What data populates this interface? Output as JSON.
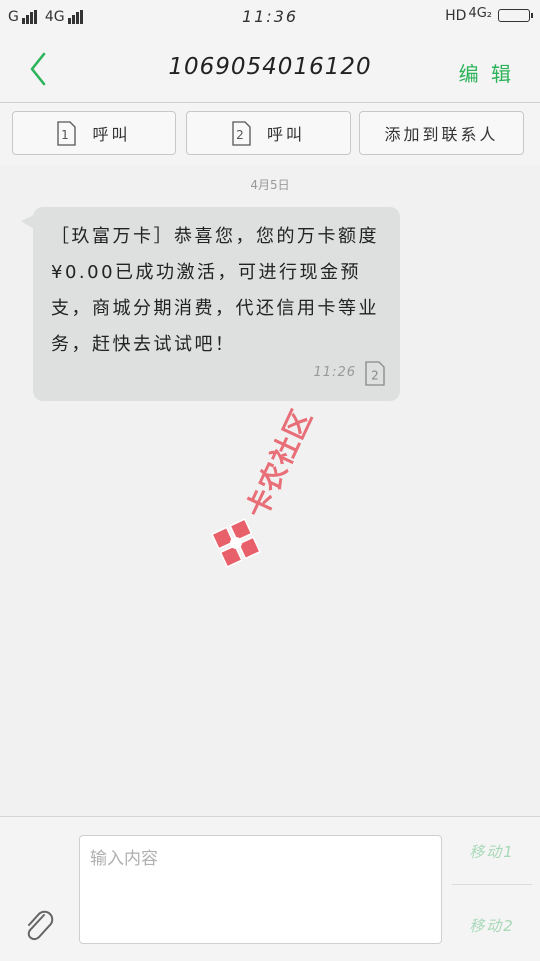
{
  "status_bar": {
    "network_left": "G",
    "network_right": "4G",
    "time": "11:36",
    "hd": "HD",
    "network_badge": "4G₂"
  },
  "header": {
    "title": "1069054016120",
    "edit_label": "编 辑"
  },
  "call_buttons": [
    {
      "sim": "1",
      "label": "呼叫"
    },
    {
      "sim": "2",
      "label": "呼叫"
    },
    {
      "label": "添加到联系人"
    }
  ],
  "conversation": {
    "date": "4月5日",
    "messages": [
      {
        "text": "［玖富万卡］恭喜您，您的万卡额度¥0.00已成功激活，可进行现金预支，商城分期消费，代还信用卡等业务，赶快去试试吧！",
        "time": "11:26",
        "sim": "2"
      }
    ]
  },
  "watermark": {
    "text": "卡农社区"
  },
  "composer": {
    "placeholder": "输入内容",
    "send_sim1": "移动1",
    "send_sim2": "移动2"
  },
  "colors": {
    "accent_green": "#2db35a",
    "send_disabled": "#a7d9b7",
    "bubble": "#dde0df",
    "watermark": "#e8606a"
  },
  "icons": {
    "back": "chevron-left-icon",
    "sim": "sim-card-icon",
    "attach": "paperclip-icon"
  }
}
